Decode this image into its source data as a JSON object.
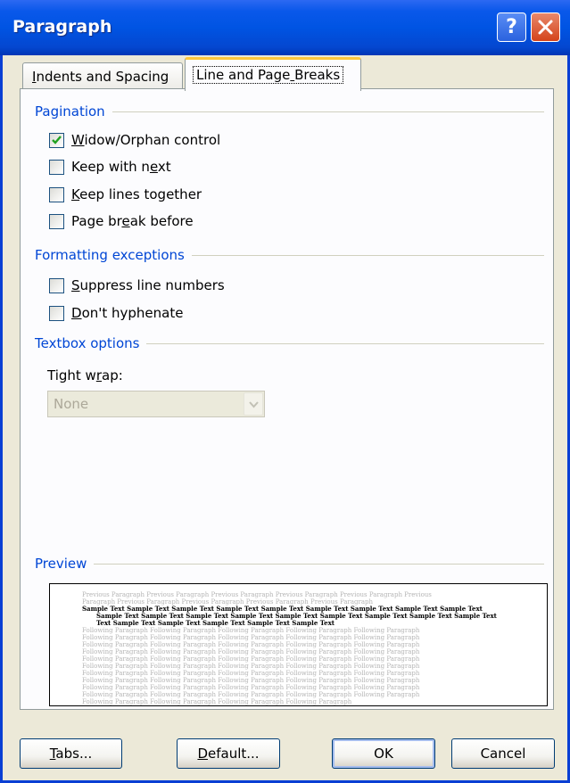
{
  "window": {
    "title": "Paragraph",
    "help_glyph": "?"
  },
  "tabs": [
    {
      "label": "Indents and Spacing",
      "mnemonic_index": 0,
      "active": false
    },
    {
      "label": "Line and Page Breaks",
      "mnemonic_index": 13,
      "active": true
    }
  ],
  "pagination": {
    "heading": "Pagination",
    "options": [
      {
        "label": "Widow/Orphan control",
        "checked": true
      },
      {
        "label": "Keep with next",
        "checked": false
      },
      {
        "label": "Keep lines together",
        "checked": false
      },
      {
        "label": "Page break before",
        "checked": false
      }
    ]
  },
  "formatting_exceptions": {
    "heading": "Formatting exceptions",
    "options": [
      {
        "label": "Suppress line numbers",
        "checked": false
      },
      {
        "label": "Don't hyphenate",
        "checked": false
      }
    ]
  },
  "textbox_options": {
    "heading": "Textbox options",
    "tight_wrap_label": "Tight wrap:",
    "tight_wrap_value": "None"
  },
  "preview": {
    "heading": "Preview",
    "previous_lines": [
      "Previous Paragraph Previous Paragraph Previous Paragraph Previous Paragraph Previous Paragraph Previous",
      "Paragraph Previous Paragraph Previous Paragraph Previous Paragraph Previous Paragraph"
    ],
    "sample_lines": [
      "Sample Text Sample Text Sample Text Sample Text Sample Text Sample Text Sample Text Sample Text Sample Text",
      "Sample Text Sample Text Sample Text Sample Text Sample Text Sample Text Sample Text Sample Text Sample Text",
      "Text Sample Text Sample Text Sample Text Sample Text Sample Text"
    ],
    "following_lines": [
      "Following Paragraph Following Paragraph Following Paragraph Following Paragraph Following Paragraph",
      "Following Paragraph Following Paragraph Following Paragraph Following Paragraph Following Paragraph",
      "Following Paragraph Following Paragraph Following Paragraph Following Paragraph Following Paragraph",
      "Following Paragraph Following Paragraph Following Paragraph Following Paragraph Following Paragraph",
      "Following Paragraph Following Paragraph Following Paragraph Following Paragraph Following Paragraph",
      "Following Paragraph Following Paragraph Following Paragraph Following Paragraph Following Paragraph",
      "Following Paragraph Following Paragraph Following Paragraph Following Paragraph Following Paragraph",
      "Following Paragraph Following Paragraph Following Paragraph Following Paragraph Following Paragraph",
      "Following Paragraph Following Paragraph Following Paragraph Following Paragraph Following Paragraph",
      "Following Paragraph Following Paragraph Following Paragraph Following Paragraph Following Paragraph",
      "Following Paragraph Following Paragraph Following Paragraph Following Paragraph"
    ]
  },
  "buttons": {
    "tabs": "Tabs...",
    "default": "Default...",
    "ok": "OK",
    "cancel": "Cancel"
  },
  "colors": {
    "title_bar": "#0054E3",
    "section_heading": "#0046D5",
    "dialog_bg": "#ECE9D8",
    "check_mark": "#21A121"
  },
  "icons": {
    "close": "close-icon",
    "help": "help-icon",
    "checkmark": "checkmark-icon",
    "dropdown": "chevron-down-icon"
  }
}
